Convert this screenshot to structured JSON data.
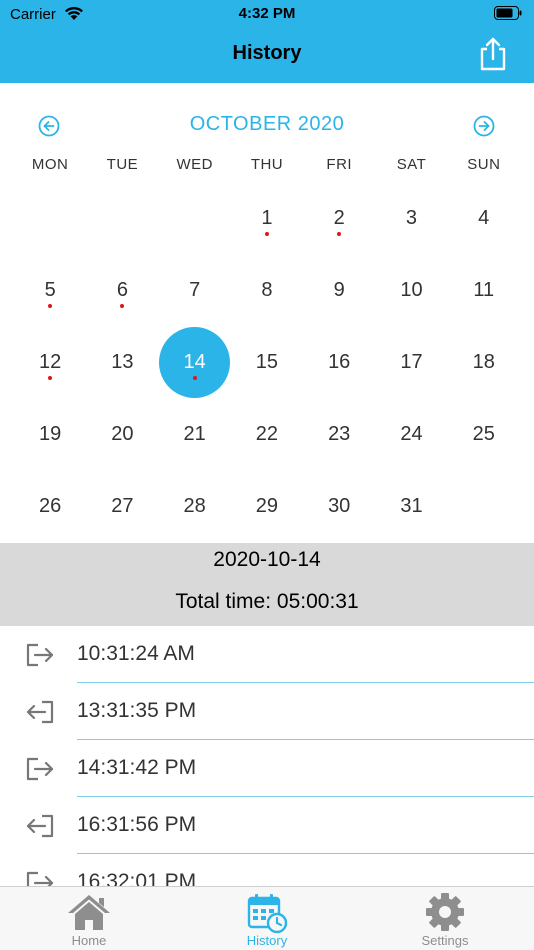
{
  "status_bar": {
    "carrier": "Carrier",
    "time": "4:32 PM"
  },
  "nav": {
    "title": "History",
    "share_icon": "share-icon"
  },
  "calendar": {
    "month_title": "OCTOBER 2020",
    "prev_icon": "arrow-left-circle-icon",
    "next_icon": "arrow-right-circle-icon",
    "weekdays": [
      "MON",
      "TUE",
      "WED",
      "THU",
      "FRI",
      "SAT",
      "SUN"
    ],
    "leading_blanks": 3,
    "days": [
      "1",
      "2",
      "3",
      "4",
      "5",
      "6",
      "7",
      "8",
      "9",
      "10",
      "11",
      "12",
      "13",
      "14",
      "15",
      "16",
      "17",
      "18",
      "19",
      "20",
      "21",
      "22",
      "23",
      "24",
      "25",
      "26",
      "27",
      "28",
      "29",
      "30",
      "31"
    ],
    "marked_days": [
      "1",
      "2",
      "5",
      "6",
      "12",
      "14"
    ],
    "selected_day": "14",
    "accent_color": "#2ab4e8",
    "marker_color": "#e0161b"
  },
  "summary": {
    "date": "2020-10-14",
    "total": "Total time: 05:00:31"
  },
  "entries": [
    {
      "type": "check-out",
      "icon": "sign-out-icon",
      "time": "10:31:24 AM"
    },
    {
      "type": "check-in",
      "icon": "sign-in-icon",
      "time": "13:31:35 PM"
    },
    {
      "type": "check-out",
      "icon": "sign-out-icon",
      "time": "14:31:42 PM"
    },
    {
      "type": "check-in",
      "icon": "sign-in-icon",
      "time": "16:31:56 PM"
    },
    {
      "type": "check-out",
      "icon": "sign-out-icon",
      "time": "16:32:01 PM"
    }
  ],
  "tabs": [
    {
      "label": "Home",
      "icon": "home-icon",
      "active": false
    },
    {
      "label": "History",
      "icon": "calendar-clock-icon",
      "active": true
    },
    {
      "label": "Settings",
      "icon": "gear-icon",
      "active": false
    }
  ]
}
